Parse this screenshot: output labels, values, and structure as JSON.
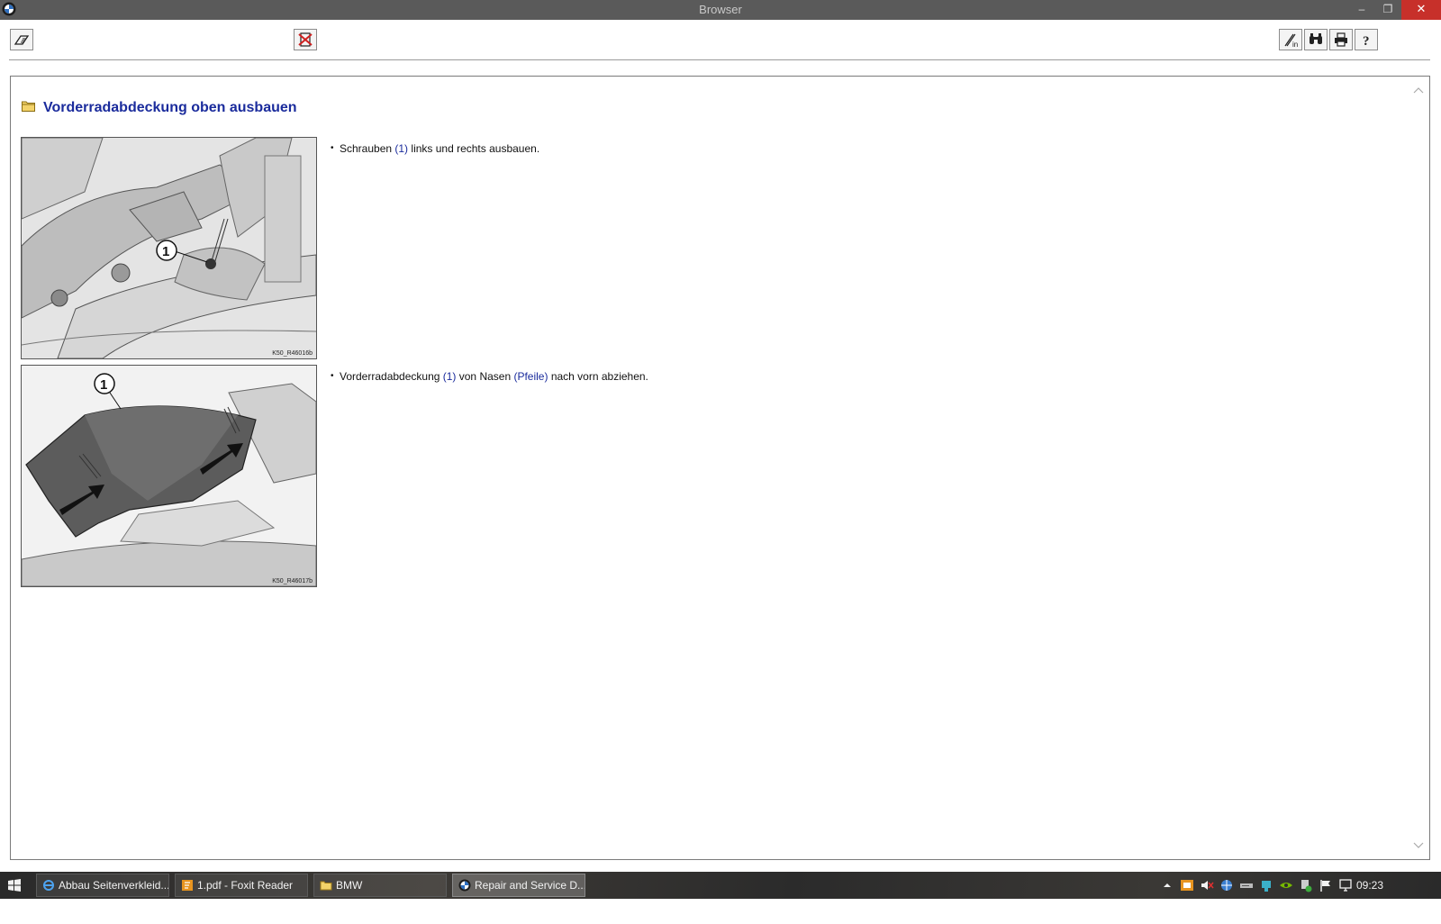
{
  "window": {
    "title": "Browser",
    "minimize_glyph": "–",
    "maximize_glyph": "❐",
    "close_glyph": "✕"
  },
  "toolbar": {
    "left_icons": [
      "service-pages-icon",
      "delete-marking-icon"
    ],
    "right_icons": [
      "notes-icon",
      "search-binoculars-icon",
      "print-icon",
      "help-icon"
    ],
    "help_glyph": "?"
  },
  "document": {
    "title": "Vorderradabdeckung oben ausbauen",
    "steps": [
      {
        "bullet": "•",
        "before": "Schrauben ",
        "ref1": "(1)",
        "middle": " links und rechts ausbauen.",
        "ref2": "",
        "after": "",
        "figure_label": "1",
        "figure_code": "K50_R46016b"
      },
      {
        "bullet": "•",
        "before": "Vorderradabdeckung ",
        "ref1": "(1)",
        "middle": " von Nasen ",
        "ref2": "(Pfeile)",
        "after": " nach vorn abziehen.",
        "figure_label": "1",
        "figure_code": "K50_R46017b"
      }
    ]
  },
  "taskbar": {
    "items": [
      {
        "label": "Abbau Seitenverkleid...",
        "icon": "internet-explorer-icon",
        "active": false
      },
      {
        "label": "1.pdf - Foxit Reader",
        "icon": "foxit-reader-icon",
        "active": false
      },
      {
        "label": "BMW",
        "icon": "folder-icon",
        "active": false
      },
      {
        "label": "Repair and Service D...",
        "icon": "bmw-logo-icon",
        "active": true
      }
    ],
    "clock": "09:23",
    "tray_icons": [
      "show-hidden-icons-icon",
      "notification-icon",
      "volume-muted-icon",
      "network-icon",
      "device-icon",
      "usb-icon",
      "nvidia-icon",
      "safely-remove-icon",
      "action-center-flag-icon",
      "network-monitor-icon"
    ]
  },
  "colors": {
    "title_bar": "#5a5a5a",
    "close_button": "#c7302a",
    "heading": "#1a2b9c",
    "reference_text": "#1a2b9c"
  }
}
